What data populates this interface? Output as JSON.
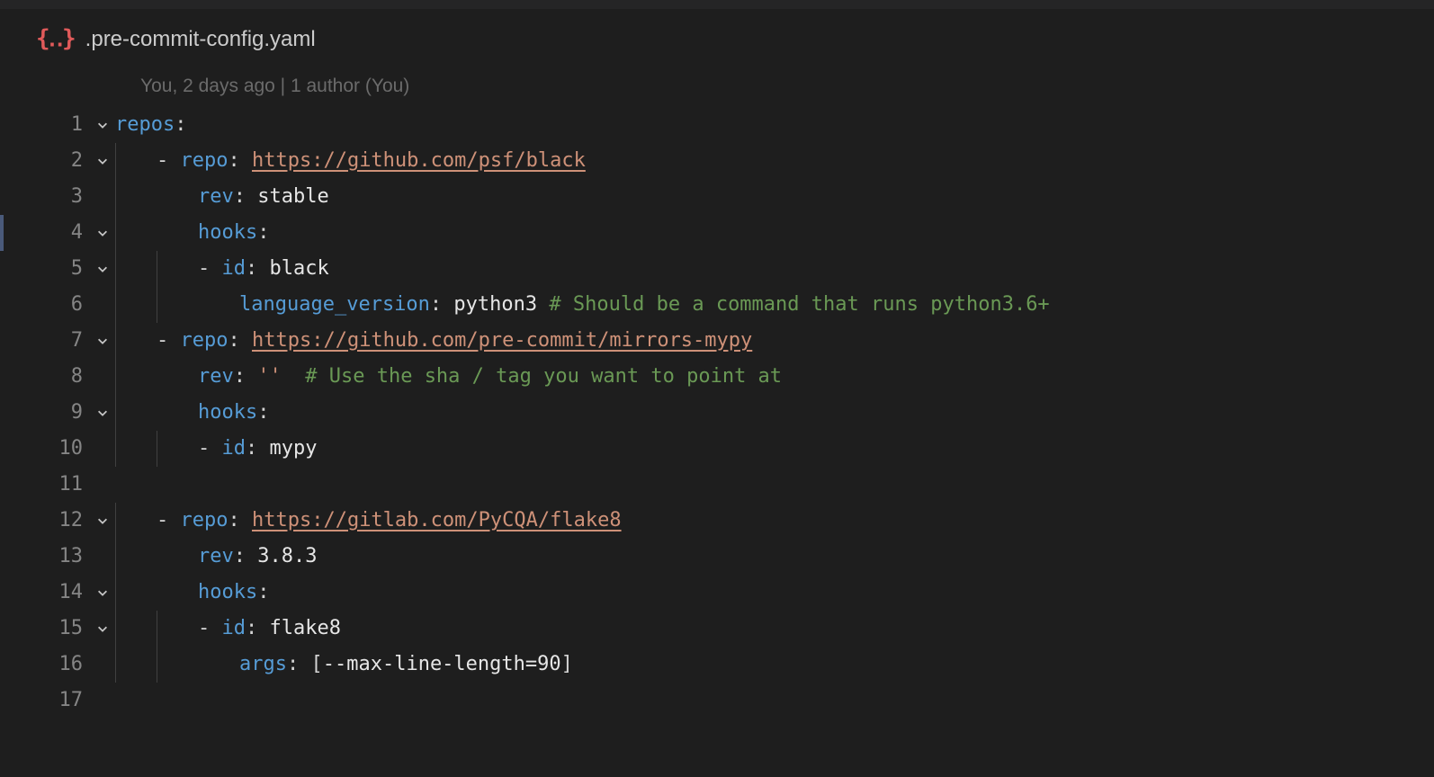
{
  "tab": {
    "icon_label": "{‥}",
    "filename": ".pre-commit-config.yaml"
  },
  "blame": "You, 2 days ago | 1 author (You)",
  "lines": [
    {
      "n": "1",
      "fold": true,
      "guides": 0,
      "indent": 0,
      "tokens": [
        [
          "key",
          "repos"
        ],
        [
          "colon",
          ":"
        ]
      ]
    },
    {
      "n": "2",
      "fold": true,
      "guides": 1,
      "indent": 0,
      "tokens": [
        [
          "dash",
          "- "
        ],
        [
          "key",
          "repo"
        ],
        [
          "colon",
          ": "
        ],
        [
          "link",
          "https://github.com/psf/black"
        ]
      ]
    },
    {
      "n": "3",
      "fold": false,
      "guides": 1,
      "indent": 1,
      "tokens": [
        [
          "key",
          "rev"
        ],
        [
          "colon",
          ": "
        ],
        [
          "num",
          "stable"
        ]
      ]
    },
    {
      "n": "4",
      "fold": true,
      "guides": 1,
      "indent": 1,
      "tokens": [
        [
          "key",
          "hooks"
        ],
        [
          "colon",
          ":"
        ]
      ]
    },
    {
      "n": "5",
      "fold": true,
      "guides": 2,
      "indent": 0,
      "tokens": [
        [
          "dash",
          "- "
        ],
        [
          "key",
          "id"
        ],
        [
          "colon",
          ": "
        ],
        [
          "num",
          "black"
        ]
      ]
    },
    {
      "n": "6",
      "fold": false,
      "guides": 2,
      "indent": 1,
      "tokens": [
        [
          "key",
          "language_version"
        ],
        [
          "colon",
          ": "
        ],
        [
          "num",
          "python3"
        ],
        [
          "comment",
          " # Should be a command that runs python3.6+"
        ]
      ]
    },
    {
      "n": "7",
      "fold": true,
      "guides": 1,
      "indent": 0,
      "tokens": [
        [
          "dash",
          "- "
        ],
        [
          "key",
          "repo"
        ],
        [
          "colon",
          ": "
        ],
        [
          "link",
          "https://github.com/pre-commit/mirrors-mypy"
        ]
      ]
    },
    {
      "n": "8",
      "fold": false,
      "guides": 1,
      "indent": 1,
      "tokens": [
        [
          "key",
          "rev"
        ],
        [
          "colon",
          ": "
        ],
        [
          "str",
          "''"
        ],
        [
          "comment",
          "  # Use the sha / tag you want to point at"
        ]
      ]
    },
    {
      "n": "9",
      "fold": true,
      "guides": 1,
      "indent": 1,
      "tokens": [
        [
          "key",
          "hooks"
        ],
        [
          "colon",
          ":"
        ]
      ]
    },
    {
      "n": "10",
      "fold": false,
      "guides": 2,
      "indent": 0,
      "tokens": [
        [
          "dash",
          "- "
        ],
        [
          "key",
          "id"
        ],
        [
          "colon",
          ": "
        ],
        [
          "num",
          "mypy"
        ]
      ]
    },
    {
      "n": "11",
      "fold": false,
      "guides": 0,
      "indent": 0,
      "tokens": []
    },
    {
      "n": "12",
      "fold": true,
      "guides": 1,
      "indent": 0,
      "tokens": [
        [
          "dash",
          "- "
        ],
        [
          "key",
          "repo"
        ],
        [
          "colon",
          ": "
        ],
        [
          "link",
          "https://gitlab.com/PyCQA/flake8"
        ]
      ]
    },
    {
      "n": "13",
      "fold": false,
      "guides": 1,
      "indent": 1,
      "tokens": [
        [
          "key",
          "rev"
        ],
        [
          "colon",
          ": "
        ],
        [
          "num",
          "3.8.3"
        ]
      ]
    },
    {
      "n": "14",
      "fold": true,
      "guides": 1,
      "indent": 1,
      "tokens": [
        [
          "key",
          "hooks"
        ],
        [
          "colon",
          ":"
        ]
      ]
    },
    {
      "n": "15",
      "fold": true,
      "guides": 2,
      "indent": 0,
      "tokens": [
        [
          "dash",
          "- "
        ],
        [
          "key",
          "id"
        ],
        [
          "colon",
          ": "
        ],
        [
          "num",
          "flake8"
        ]
      ]
    },
    {
      "n": "16",
      "fold": false,
      "guides": 2,
      "indent": 1,
      "tokens": [
        [
          "key",
          "args"
        ],
        [
          "colon",
          ": "
        ],
        [
          "bracket",
          "["
        ],
        [
          "num",
          "--max-line-length=90"
        ],
        [
          "bracket",
          "]"
        ]
      ]
    },
    {
      "n": "17",
      "fold": false,
      "guides": 0,
      "indent": 0,
      "tokens": []
    }
  ]
}
